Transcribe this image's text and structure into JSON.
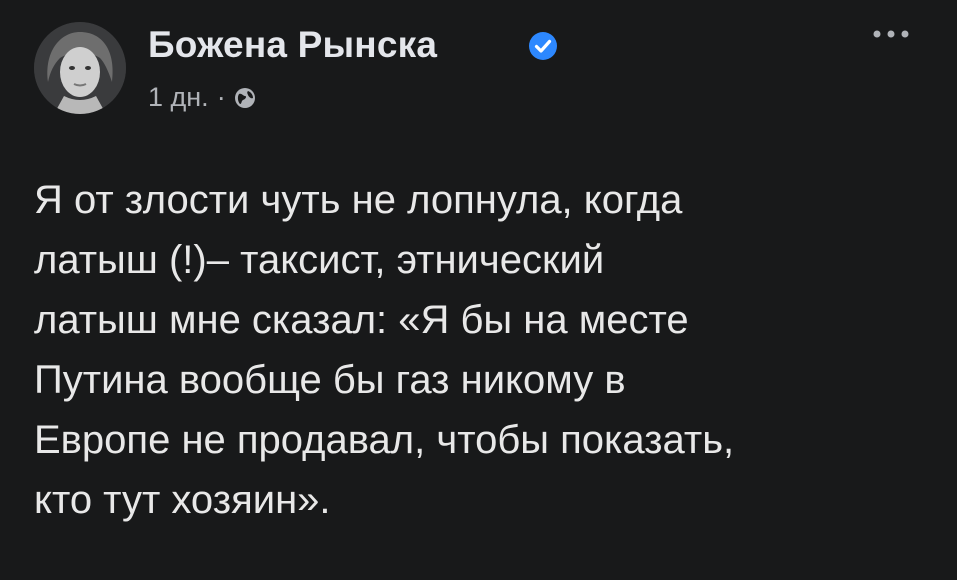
{
  "post": {
    "author": {
      "name": "Божена Рынска",
      "verified": true,
      "avatar_icon": "profile-photo"
    },
    "timestamp": "1 дн.",
    "separator": "·",
    "audience_icon": "globe-icon",
    "more_icon": "more-horizontal-icon",
    "text": "Я от злости чуть не лопнула, когда латыш (!)– таксист, этнический латыш мне сказал: «Я бы на месте Путина вообще бы газ никому в Европе не продавал, чтобы показать, кто тут хозяин».",
    "lines": [
      "Я от злости чуть не лопнула, когда",
      "латыш (!)– таксист, этнический",
      "латыш мне сказал: «Я бы на месте",
      "Путина вообще бы газ никому в",
      "Европе не продавал, чтобы показать,",
      "кто тут хозяин»."
    ]
  },
  "colors": {
    "background": "#18191a",
    "name": "#e4e6eb",
    "meta": "#b0b3b8",
    "verified": "#2d88ff"
  }
}
